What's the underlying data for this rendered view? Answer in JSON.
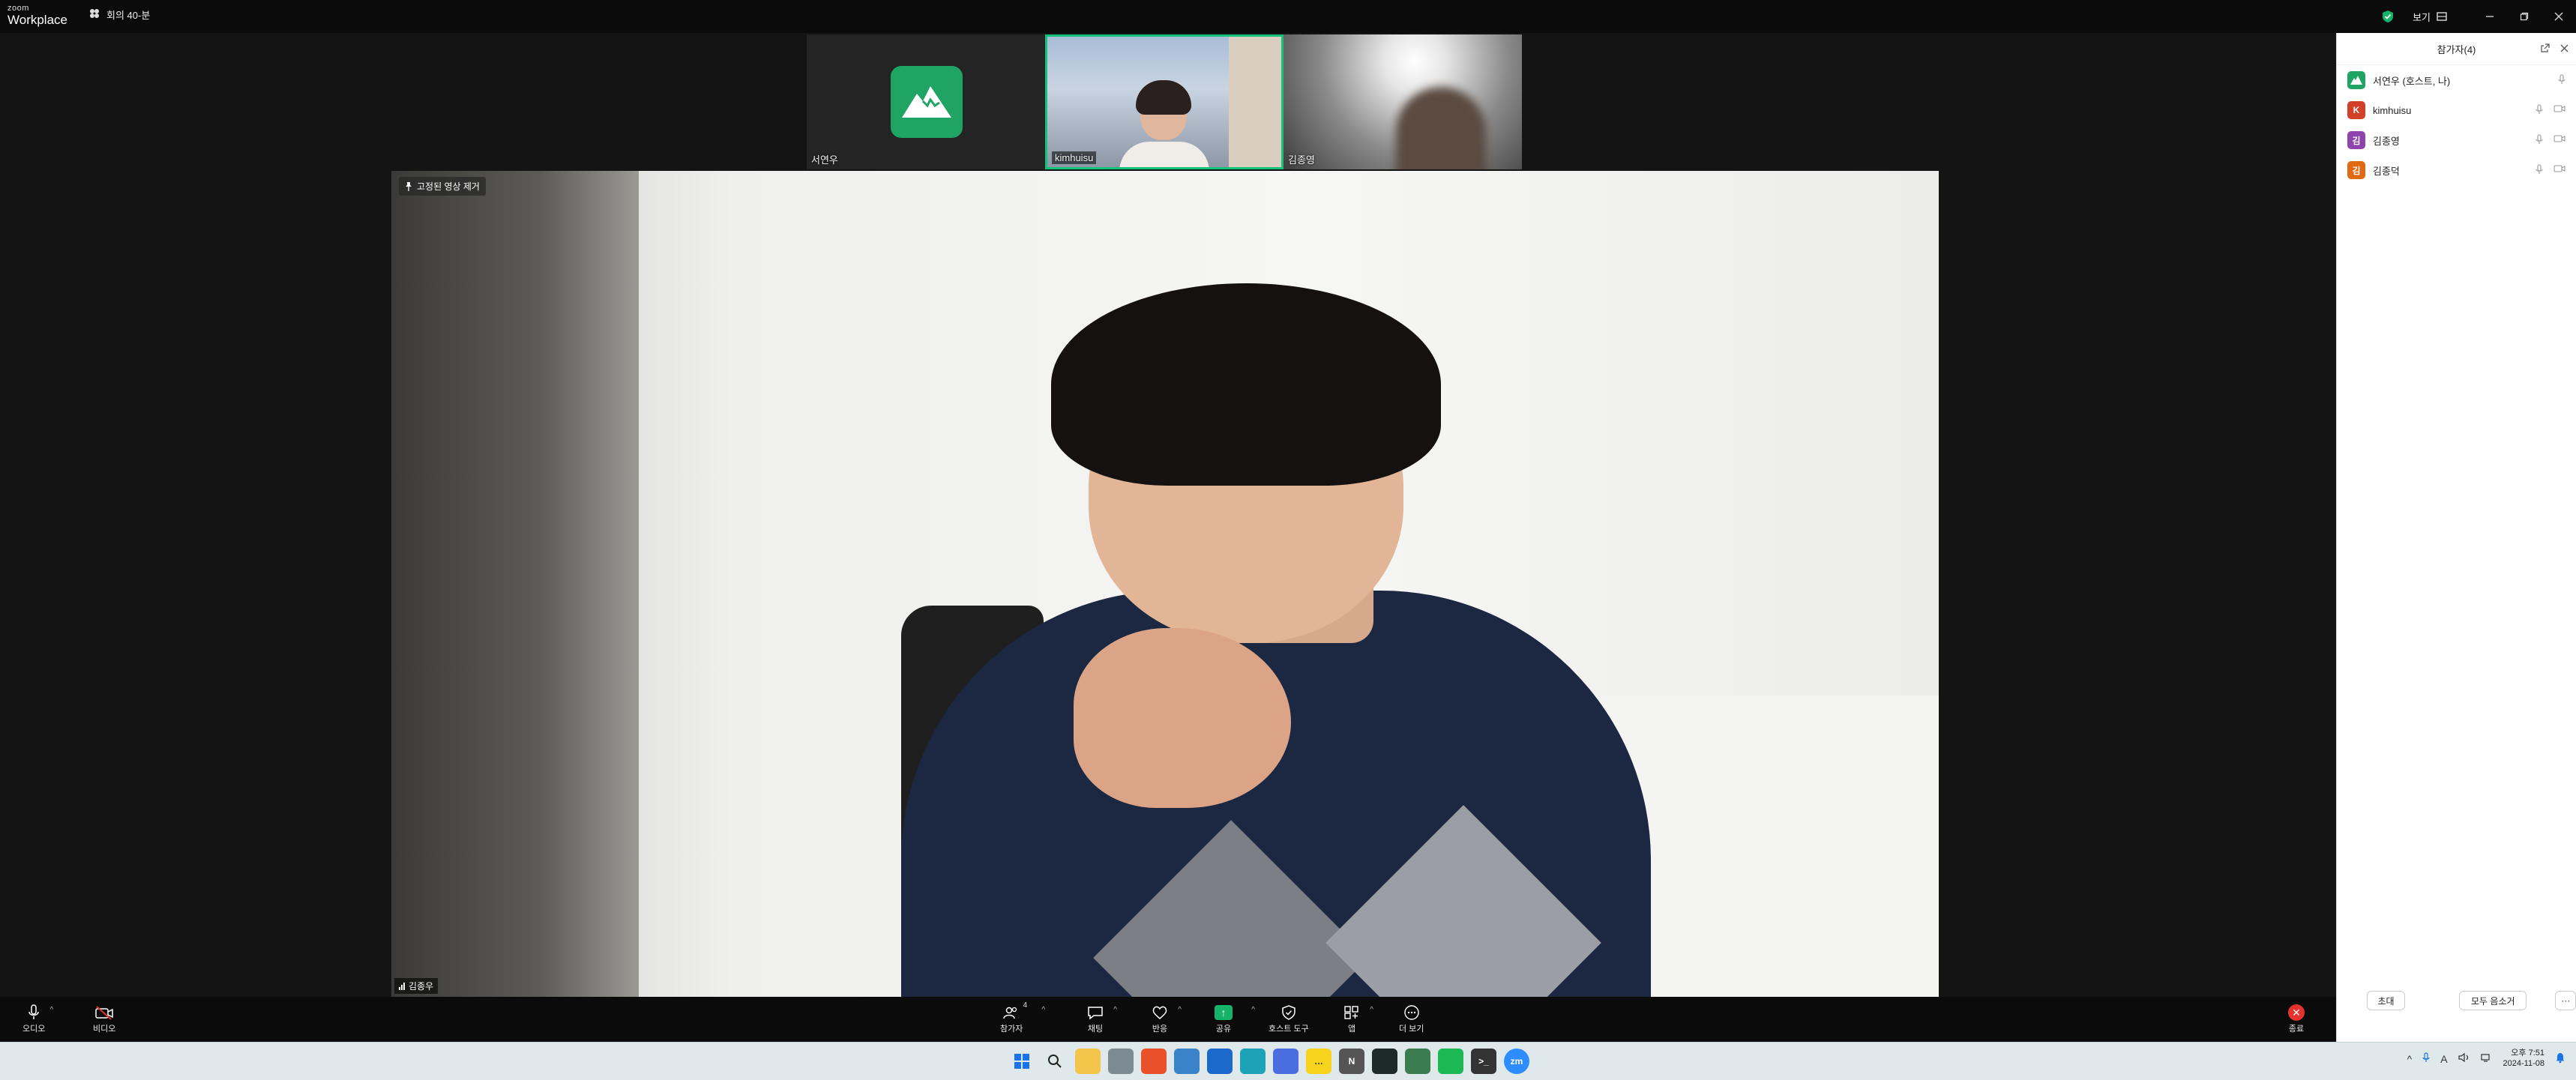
{
  "app": {
    "logo_line1": "zoom",
    "logo_line2": "Workplace",
    "meeting_label": "회의 40-분",
    "view_label": "보기"
  },
  "thumbnails": [
    {
      "name": "서연우",
      "kind": "avatar"
    },
    {
      "name": "kimhuisu",
      "kind": "camera"
    },
    {
      "name": "김종영",
      "kind": "blur"
    }
  ],
  "main_video": {
    "pin_label": "고정된 영상 제거",
    "speaker_name": "김종우"
  },
  "panel": {
    "title": "참가자(4)",
    "participants": [
      {
        "name": "서연우 (호스트, 나)",
        "initial": "",
        "color": "#1fa463"
      },
      {
        "name": "kimhuisu",
        "initial": "K",
        "color": "#d24027"
      },
      {
        "name": "김종영",
        "initial": "김",
        "color": "#8e44ad"
      },
      {
        "name": "김종덕",
        "initial": "김",
        "color": "#e06a12"
      }
    ],
    "invite_label": "초대",
    "mute_all_label": "모두 음소거",
    "more_label": "···"
  },
  "toolbar": {
    "audio_label": "오디오",
    "video_label": "비디오",
    "participants_label": "참가자",
    "participants_count": "4",
    "chat_label": "채팅",
    "react_label": "반응",
    "share_label": "공유",
    "host_tools_label": "호스트 도구",
    "apps_label": "앱",
    "more_label": "더 보기",
    "end_label": "종료"
  },
  "taskbar": {
    "time": "오후 7:51",
    "date": "2024-11-08",
    "lang": "A"
  },
  "colors": {
    "accent_green": "#15c27a",
    "end_red": "#e5322d",
    "share_green": "#17b26a"
  }
}
